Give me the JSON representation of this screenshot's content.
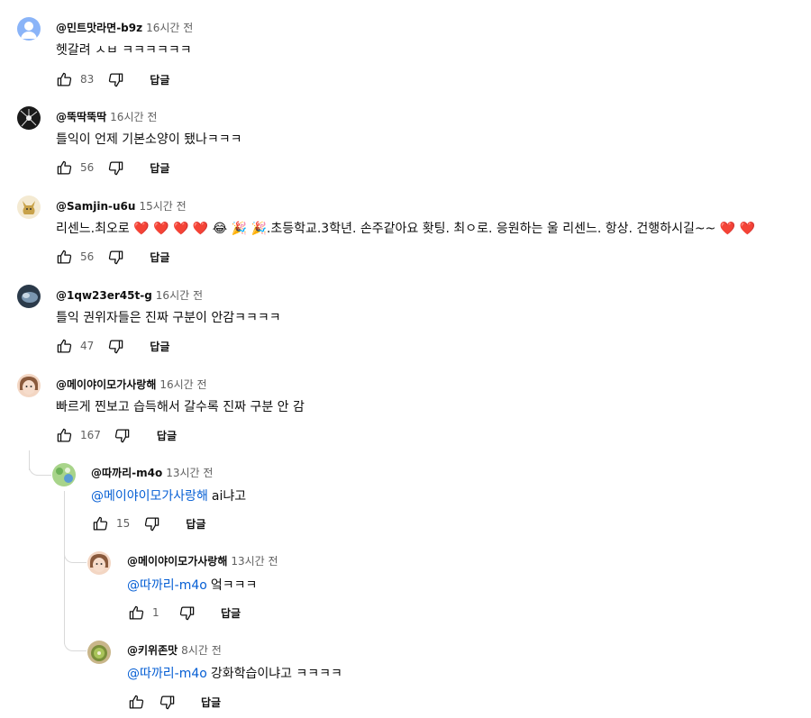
{
  "ui": {
    "reply_label": "답글",
    "link_color": "#065fd4"
  },
  "comments": [
    {
      "author": "@민트맛라면-b9z",
      "time": "16시간 전",
      "text": "헷갈려 ㅅㅂ ㅋㅋㅋㅋㅋㅋ",
      "likes": "83"
    },
    {
      "author": "@뚝딱뚝딱",
      "time": "16시간 전",
      "text": "틀익이 언제 기본소양이 됐나ㅋㅋㅋ",
      "likes": "56"
    },
    {
      "author": "@Samjin-u6u",
      "time": "15시간 전",
      "text_parts": [
        "리센느.최오로",
        "❤️",
        "❤️",
        "❤️",
        "❤️",
        "😂",
        "🎉",
        "🎉",
        ".초등학교.3학년. 손주같아요 홧팅. 최ㅇ로. 응원하는 울 리센느. 항상. 건행하시길~~",
        "❤️",
        "❤️"
      ],
      "likes": "56"
    },
    {
      "author": "@1qw23er45t-g",
      "time": "16시간 전",
      "text": "틀익 권위자들은 진짜 구분이 안감ㅋㅋㅋㅋ",
      "likes": "47"
    },
    {
      "author": "@메이야이모가사랑해",
      "time": "16시간 전",
      "text": "빠르게 찐보고 습득해서 갈수록 진짜 구분 안 감",
      "likes": "167"
    }
  ],
  "replies": [
    {
      "author": "@따까리-m4o",
      "time": "13시간 전",
      "mention": "@메이야이모가사랑해",
      "text": "ai냐고",
      "likes": "15"
    },
    {
      "author": "@메이야이모가사랑해",
      "time": "13시간 전",
      "mention": "@따까리-m4o",
      "text": "엌ㅋㅋㅋ",
      "likes": "1"
    },
    {
      "author": "@키위존맛",
      "time": "8시간 전",
      "mention": "@따까리-m4o",
      "text": "강화학습이냐고 ㅋㅋㅋㅋ",
      "likes": ""
    }
  ]
}
